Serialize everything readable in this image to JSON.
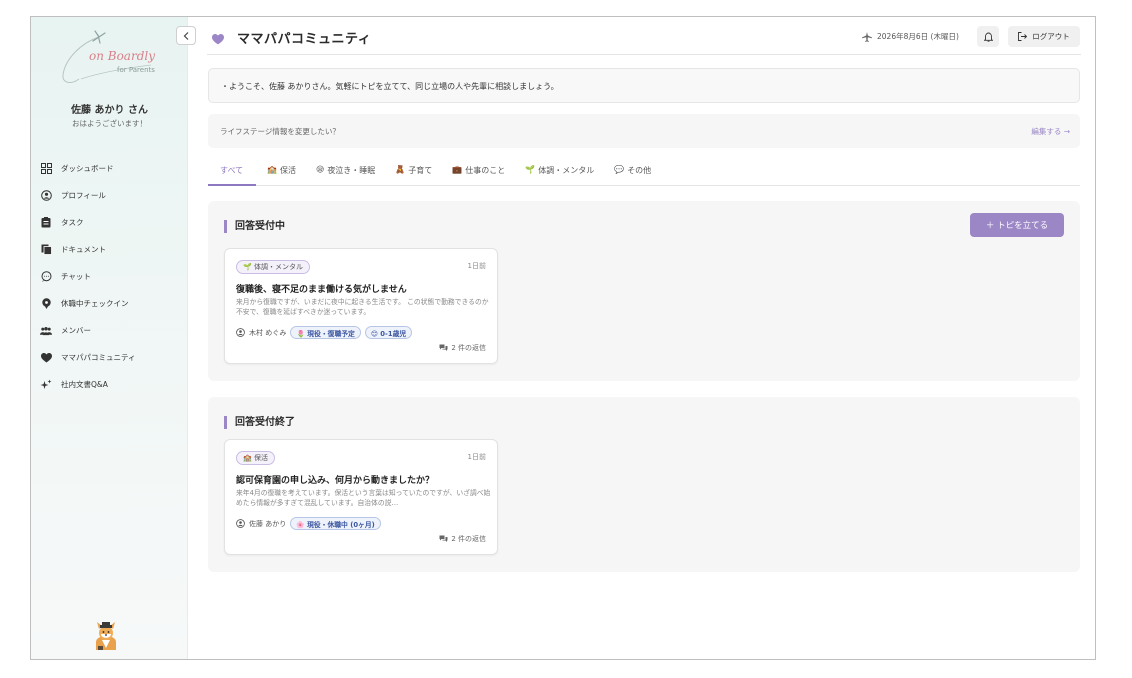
{
  "brand": {
    "name": "on Boardly",
    "tagline": "for Parents"
  },
  "user": {
    "name": "佐藤 あかり さん",
    "greeting": "おはようございます！"
  },
  "sidebar": {
    "items": [
      {
        "label": "ダッシュボード",
        "icon": "grid-icon"
      },
      {
        "label": "プロフィール",
        "icon": "user-circle-icon"
      },
      {
        "label": "タスク",
        "icon": "clipboard-icon"
      },
      {
        "label": "ドキュメント",
        "icon": "documents-icon"
      },
      {
        "label": "チャット",
        "icon": "chat-bubble-icon"
      },
      {
        "label": "休職中チェックイン",
        "icon": "pin-icon"
      },
      {
        "label": "メンバー",
        "icon": "people-icon"
      },
      {
        "label": "ママパパコミュニティ",
        "icon": "heart-icon"
      },
      {
        "label": "社内文書Q&A",
        "icon": "sparkle-icon"
      }
    ]
  },
  "header": {
    "title": "ママパパコミュニティ",
    "date": "2026年8月6日 (木曜日)",
    "logout_label": "ログアウト"
  },
  "welcome": {
    "message": "・ようこそ、佐藤 あかりさん。気軽にトピを立てて、同じ立場の人や先輩に相談しましょう。"
  },
  "lifestage": {
    "question": "ライフステージ情報を変更したい？",
    "edit_label": "編集する →"
  },
  "tabs": [
    {
      "label": "すべて",
      "emoji": ""
    },
    {
      "label": "保活",
      "emoji": "🏫"
    },
    {
      "label": "夜泣き・睡眠",
      "emoji": "😪"
    },
    {
      "label": "子育て",
      "emoji": "🧸"
    },
    {
      "label": "仕事のこと",
      "emoji": "💼"
    },
    {
      "label": "体調・メンタル",
      "emoji": "🌱"
    },
    {
      "label": "その他",
      "emoji": "💬"
    }
  ],
  "sections": {
    "open": {
      "title": "回答受付中",
      "new_topic_label": "＋ トピを立てる",
      "card": {
        "tag": "🌱 体調・メンタル",
        "time": "1日前",
        "title": "復職後、寝不足のまま働ける気がしません",
        "body": "来月から復職ですが、いまだに夜中に起きる生活です。 この状態で勤務できるのか不安で、復職を延ばすべきか迷っています。",
        "author": "木村 めぐみ",
        "chips": [
          "🌷 現役・復職予定",
          "😊 0-1歳児"
        ],
        "replies": "2 件の返信"
      }
    },
    "closed": {
      "title": "回答受付終了",
      "card": {
        "tag": "🏫 保活",
        "time": "1日前",
        "title": "認可保育園の申し込み、何月から動きましたか？",
        "body": "来年4月の復職を考えています。保活という言葉は知っていたのですが、いざ調べ始めたら情報が多すぎて混乱しています。自治体の説…",
        "author": "佐藤 あかり",
        "chips": [
          "🌸 現役・休職中 (0ヶ月)"
        ],
        "replies": "2 件の返信"
      }
    }
  },
  "colors": {
    "accent": "#9b87c6",
    "sidebar_bg": "#e8f4f2",
    "chip_text": "#3b55a0"
  }
}
